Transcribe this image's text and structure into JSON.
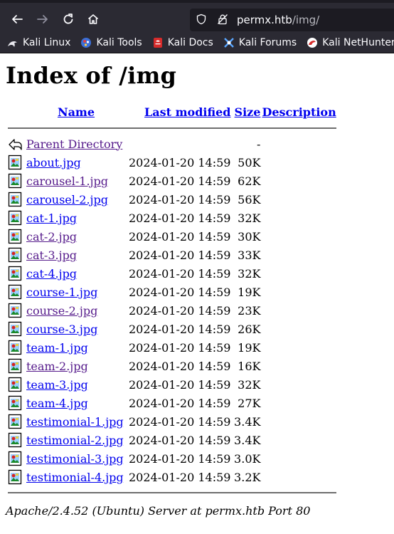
{
  "browser": {
    "url_host": "permx.htb",
    "url_path": "/img/",
    "bookmarks": [
      {
        "label": "Kali Linux",
        "icon": "kali-dragon-icon"
      },
      {
        "label": "Kali Tools",
        "icon": "kali-tools-icon"
      },
      {
        "label": "Kali Docs",
        "icon": "kali-docs-icon"
      },
      {
        "label": "Kali Forums",
        "icon": "kali-forums-icon"
      },
      {
        "label": "Kali NetHunter",
        "icon": "kali-nethunter-icon"
      }
    ]
  },
  "page": {
    "title": "Index of /img",
    "columns": {
      "name": "Name",
      "last_modified": "Last modified",
      "size": "Size",
      "description": "Description"
    },
    "parent": {
      "name": "Parent Directory",
      "size": "-"
    },
    "files": [
      {
        "name": "about.jpg",
        "modified": "2024-01-20 14:59",
        "size": "50K",
        "visited": false
      },
      {
        "name": "carousel-1.jpg",
        "modified": "2024-01-20 14:59",
        "size": "62K",
        "visited": true
      },
      {
        "name": "carousel-2.jpg",
        "modified": "2024-01-20 14:59",
        "size": "56K",
        "visited": false
      },
      {
        "name": "cat-1.jpg",
        "modified": "2024-01-20 14:59",
        "size": "32K",
        "visited": false
      },
      {
        "name": "cat-2.jpg",
        "modified": "2024-01-20 14:59",
        "size": "30K",
        "visited": true
      },
      {
        "name": "cat-3.jpg",
        "modified": "2024-01-20 14:59",
        "size": "33K",
        "visited": true
      },
      {
        "name": "cat-4.jpg",
        "modified": "2024-01-20 14:59",
        "size": "32K",
        "visited": false
      },
      {
        "name": "course-1.jpg",
        "modified": "2024-01-20 14:59",
        "size": "19K",
        "visited": false
      },
      {
        "name": "course-2.jpg",
        "modified": "2024-01-20 14:59",
        "size": "23K",
        "visited": true
      },
      {
        "name": "course-3.jpg",
        "modified": "2024-01-20 14:59",
        "size": "26K",
        "visited": false
      },
      {
        "name": "team-1.jpg",
        "modified": "2024-01-20 14:59",
        "size": "19K",
        "visited": false
      },
      {
        "name": "team-2.jpg",
        "modified": "2024-01-20 14:59",
        "size": "16K",
        "visited": true
      },
      {
        "name": "team-3.jpg",
        "modified": "2024-01-20 14:59",
        "size": "32K",
        "visited": false
      },
      {
        "name": "team-4.jpg",
        "modified": "2024-01-20 14:59",
        "size": "27K",
        "visited": false
      },
      {
        "name": "testimonial-1.jpg",
        "modified": "2024-01-20 14:59",
        "size": "3.4K",
        "visited": false
      },
      {
        "name": "testimonial-2.jpg",
        "modified": "2024-01-20 14:59",
        "size": "3.4K",
        "visited": false
      },
      {
        "name": "testimonial-3.jpg",
        "modified": "2024-01-20 14:59",
        "size": "3.0K",
        "visited": false
      },
      {
        "name": "testimonial-4.jpg",
        "modified": "2024-01-20 14:59",
        "size": "3.2K",
        "visited": false
      }
    ],
    "footer": "Apache/2.4.52 (Ubuntu) Server at permx.htb Port 80"
  }
}
